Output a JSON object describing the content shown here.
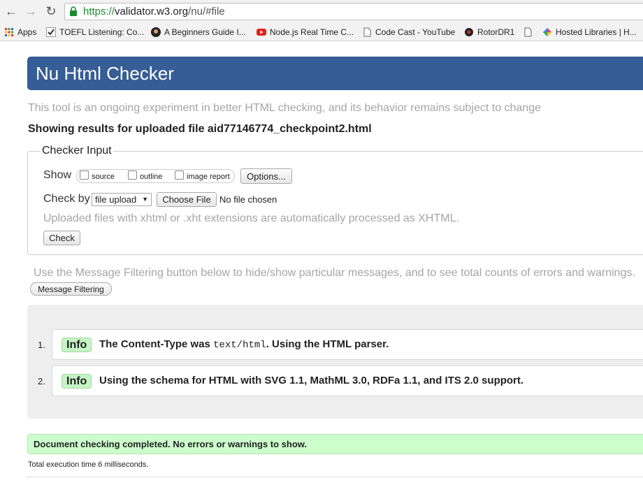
{
  "browser": {
    "url_https": "https://",
    "url_host": "validator.w3.org",
    "url_path": "/nu/#file",
    "bookmarks": [
      {
        "label": "Apps",
        "icon": "apps-grid-icon"
      },
      {
        "label": "TOEFL Listening: Co...",
        "icon": "checkmark-icon"
      },
      {
        "label": "A Beginners Guide I...",
        "icon": "avatar-icon"
      },
      {
        "label": "Node.js Real Time C...",
        "icon": "youtube-icon"
      },
      {
        "label": "Code Cast - YouTube",
        "icon": "page-icon"
      },
      {
        "label": "RotorDR1",
        "icon": "circle-icon"
      },
      {
        "label": "",
        "icon": "page-icon"
      },
      {
        "label": "Hosted Libraries | H...",
        "icon": "google-icon"
      }
    ]
  },
  "page": {
    "title": "Nu Html Checker",
    "intro": "This tool is an ongoing experiment in better HTML checking, and its behavior remains subject to change",
    "showing": "Showing results for uploaded file aid77146774_checkpoint2.html"
  },
  "checker_input": {
    "legend": "Checker Input",
    "show_label": "Show",
    "options": [
      {
        "label": "source",
        "checked": false
      },
      {
        "label": "outline",
        "checked": false
      },
      {
        "label": "image report",
        "checked": false
      }
    ],
    "options_button": "Options...",
    "check_by_label": "Check by",
    "check_by_value": "file upload",
    "choose_file_button": "Choose File",
    "no_file": "No file chosen",
    "upload_note": "Uploaded files with xhtml or .xht extensions are automatically processed as XHTML.",
    "check_button": "Check"
  },
  "filter": {
    "note": "Use the Message Filtering button below to hide/show particular messages, and to see total counts of errors and warnings.",
    "button": "Message Filtering"
  },
  "messages": [
    {
      "number": "1.",
      "type": "Info",
      "text_before": "The Content-Type was ",
      "code": "text/html",
      "text_after": ". Using the HTML parser."
    },
    {
      "number": "2.",
      "type": "Info",
      "text_before": "Using the schema for HTML with SVG 1.1, MathML 3.0, RDFa 1.1, and ITS 2.0 support.",
      "code": "",
      "text_after": ""
    }
  ],
  "status": {
    "complete": "Document checking completed. No errors or warnings to show.",
    "exec_time": "Total execution time 6 milliseconds."
  },
  "colors": {
    "title_bar": "#365d95",
    "info_badge": "#c5f5c5",
    "success_bar": "#ccffcc"
  }
}
